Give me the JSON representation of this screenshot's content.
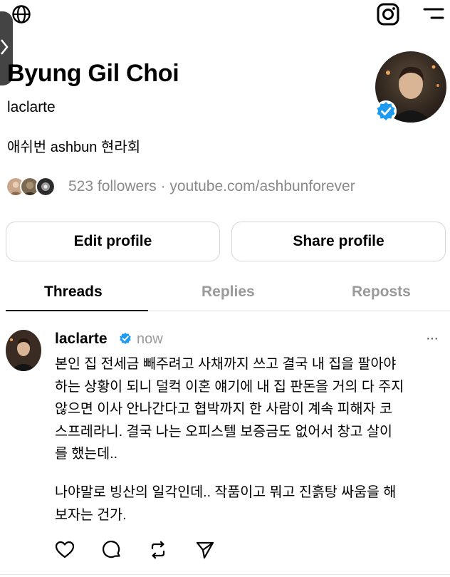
{
  "profile": {
    "display_name": "Byung Gil Choi",
    "username": "laclarte",
    "bio": "애쉬번 ashbun 현라회",
    "followers": "523 followers · youtube.com/ashbunforever",
    "verified": true
  },
  "buttons": {
    "edit_label": "Edit profile",
    "share_label": "Share profile"
  },
  "tabs": [
    {
      "label": "Threads",
      "active": true
    },
    {
      "label": "Replies",
      "active": false
    },
    {
      "label": "Reposts",
      "active": false
    }
  ],
  "post": {
    "username": "laclarte",
    "time": "now",
    "more": "···",
    "paragraph1": "본인 집 전세금 빼주려고 사채까지 쓰고 결국 내 집을 팔아야\n하는 상황이 되니 덜컥 이혼 얘기에 내 집 판돈을 거의 다 주지\n않으면 이사 안나간다고 협박까지 한 사람이 계속 피해자 코\n스프레라니. 결국 나는 오피스텔 보증금도 없어서 창고 살이\n를 했는데..",
    "paragraph2": "나야말로 빙산의 일각인데.. 작품이고 뭐고 진흙탕 싸움을 해\n보자는 건가."
  },
  "icons": {
    "top_left": "globe-icon",
    "top_right": [
      "instagram-icon",
      "menu-icon"
    ],
    "actions": [
      "heart-icon",
      "comment-icon",
      "repost-icon",
      "share-icon"
    ]
  },
  "colors": {
    "verified": "#1d9bf0",
    "muted": "#9a9a9a",
    "border": "#d6d6d6"
  }
}
